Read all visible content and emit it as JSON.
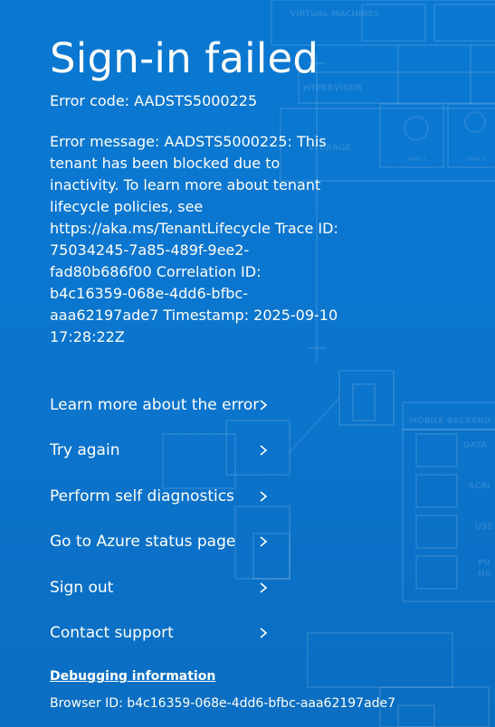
{
  "page": {
    "title": "Sign-in failed",
    "error_code": "Error code: AADSTS5000225",
    "error_message": "Error message: AADSTS5000225: This tenant has been blocked due to inactivity. To learn more about tenant lifecycle policies, see https://aka.ms/TenantLifecycle Trace ID: 75034245-7a85-489f-9ee2-fad80b686f00 Correlation ID: b4c16359-068e-4dd6-bfbc-aaa62197ade7 Timestamp: 2025-09-10 17:28:22Z"
  },
  "actions": [
    {
      "label": "Learn more about the error",
      "icon": "chevron-right-icon"
    },
    {
      "label": "Try again",
      "icon": "chevron-right-icon"
    },
    {
      "label": "Perform self diagnostics",
      "icon": "chevron-right-icon"
    },
    {
      "label": "Go to Azure status page",
      "icon": "chevron-right-icon"
    },
    {
      "label": "Sign out",
      "icon": "chevron-right-icon"
    },
    {
      "label": "Contact support",
      "icon": "chevron-right-icon"
    }
  ],
  "debug": {
    "heading": "Debugging information",
    "browser_id": "Browser ID: b4c16359-068e-4dd6-bfbc-aaa62197ade7"
  },
  "background_art": {
    "labels": [
      "VIRTUAL MACHINES",
      "HYPERVISOR",
      "STORAGE",
      "VHD 1",
      "VHD 2",
      "MOBILE BACKEND S",
      "DATA",
      "SCRI",
      "USE",
      "PU",
      "NO"
    ]
  },
  "colors": {
    "background": "#0a78d1",
    "text": "#ffffff"
  }
}
